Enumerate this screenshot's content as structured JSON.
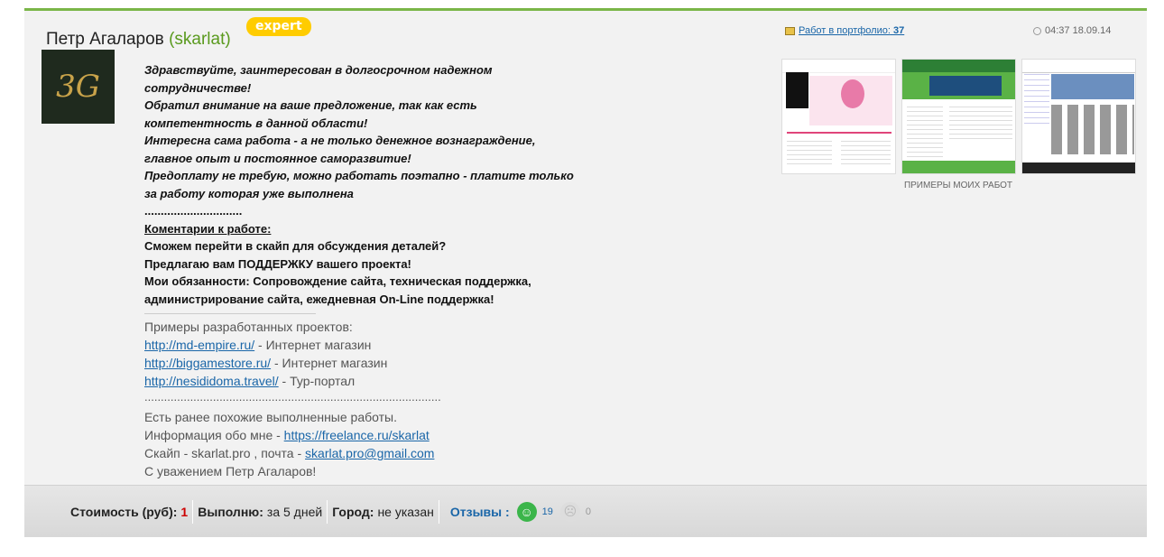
{
  "user": {
    "name": "Петр Агаларов",
    "login": "(skarlat)",
    "badge": "expert",
    "avatar_text": "3G"
  },
  "portfolio": {
    "label": "Работ в портфолио:",
    "count": "37"
  },
  "time": "04:37 18.09.14",
  "examples_caption": "ПРИМЕРЫ МОИХ РАБОТ",
  "message": {
    "l1": "Здравствуйте, заинтересован в долгосрочном надежном",
    "l2": "сотрудничестве!",
    "l3": "Обратил внимание на ваше предложение, так как есть",
    "l4": "компетентность в данной области!",
    "l5": "Интересна сама работа - а не только денежное вознаграждение,",
    "l6": "главное опыт и постоянное саморазвитие!",
    "l7": "Предоплату не требую, можно работать поэтапно - платите только",
    "l8": "за работу которая уже выполнена",
    "dots1": "..............................",
    "comments_title": "Коментарии к работе:",
    "c1": "Сможем перейти в скайп для обсуждения деталей?",
    "c2": "Предлагаю вам ПОДДЕРЖКУ вашего проекта!",
    "c3": "Мои обязанности: Сопровождение сайта, техническая поддержка,",
    "c4": "администрирование сайта, ежедневная On-Line поддержка!",
    "projects_title": "Примеры разработанных проектов:",
    "projects": [
      {
        "url": "http://md-empire.ru/",
        "desc": " - Интернет магазин"
      },
      {
        "url": "http://biggamestore.ru/",
        "desc": " - Интернет магазин"
      },
      {
        "url": "http://nesididoma.travel/",
        "desc": " - Тур-портал"
      }
    ],
    "dots2": "...........................................................................................",
    "g1": "Есть ранее похожие выполненные работы.",
    "g2_prefix": "Информация обо мне - ",
    "g2_link": "https://freelance.ru/skarlat",
    "g3_prefix": "Скайп - skarlat.pro , почта - ",
    "g3_link": "skarlat.pro@gmail.com",
    "g4": "С уважением Петр Агаларов!"
  },
  "footer": {
    "cost_label": "Стоимость (руб):",
    "cost_value": "1",
    "term_label": "Выполню:",
    "term_value": "за 5 дней",
    "city_label": "Город:",
    "city_value": "не указан",
    "reviews_label": "Отзывы :",
    "positive": "19",
    "negative": "0"
  }
}
